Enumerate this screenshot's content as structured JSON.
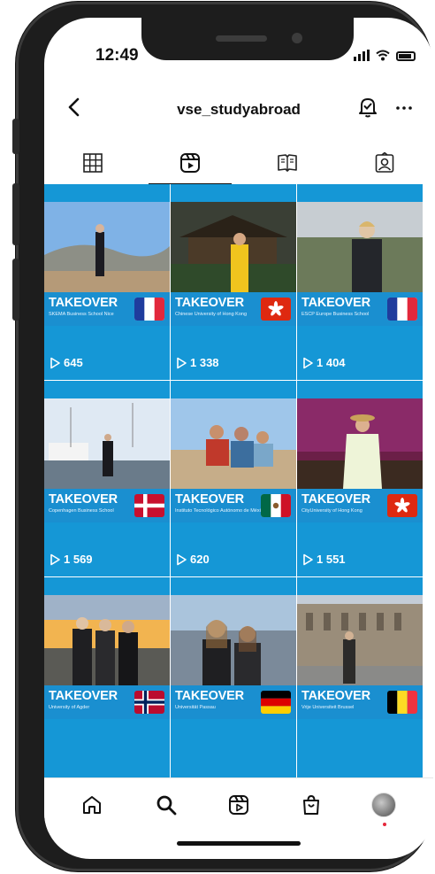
{
  "status": {
    "time": "12:49"
  },
  "header": {
    "username": "vse_studyabroad"
  },
  "tabs": [
    {
      "name": "grid",
      "icon": "grid-icon",
      "active": false
    },
    {
      "name": "reels",
      "icon": "reels-icon",
      "active": true
    },
    {
      "name": "guides",
      "icon": "guides-icon",
      "active": false
    },
    {
      "name": "tagged",
      "icon": "tagged-icon",
      "active": false
    }
  ],
  "posts": [
    {
      "title": "TAKEOVER",
      "school": "SKEMA Business School Nice",
      "flag": "france",
      "views": "645"
    },
    {
      "title": "TAKEOVER",
      "school": "Chinese University of Hong Kong",
      "flag": "hongkong",
      "views": "1 338"
    },
    {
      "title": "TAKEOVER",
      "school": "ESCP Europe Business School",
      "flag": "france",
      "views": "1 404"
    },
    {
      "title": "TAKEOVER",
      "school": "Copenhagen Business School",
      "flag": "denmark",
      "views": "1 569"
    },
    {
      "title": "TAKEOVER",
      "school": "Instituto Tecnológico Autónomo de México",
      "flag": "mexico",
      "views": "620"
    },
    {
      "title": "TAKEOVER",
      "school": "CityUniversity of Hong Kong",
      "flag": "hongkong",
      "views": "1 551"
    },
    {
      "title": "TAKEOVER",
      "school": "University of Agder",
      "flag": "norway",
      "views": ""
    },
    {
      "title": "TAKEOVER",
      "school": "Universität Passau",
      "flag": "germany",
      "views": ""
    },
    {
      "title": "TAKEOVER",
      "school": "Vrije Universiteit Brussel",
      "flag": "belgium",
      "views": ""
    }
  ],
  "bottom_nav": [
    {
      "name": "home",
      "icon": "home-icon"
    },
    {
      "name": "search",
      "icon": "search-icon"
    },
    {
      "name": "reels",
      "icon": "reels-icon"
    },
    {
      "name": "shop",
      "icon": "shop-icon"
    },
    {
      "name": "profile",
      "icon": "avatar"
    }
  ],
  "colors": {
    "accent_blue": "#1597d6",
    "notification_dot": "#e5283c"
  }
}
